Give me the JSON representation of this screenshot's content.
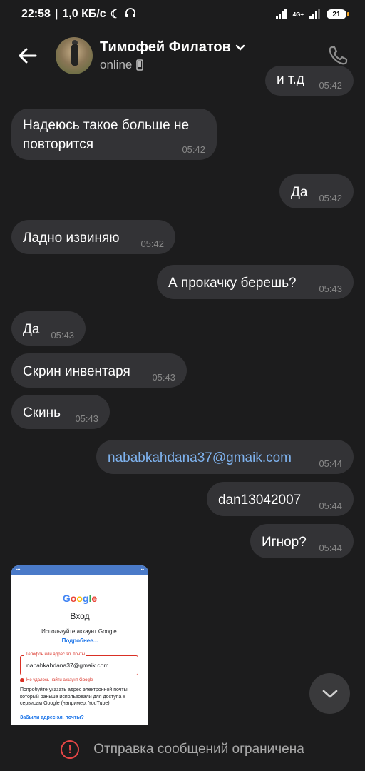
{
  "status_bar": {
    "time": "22:58",
    "speed": "1,0 КБ/с",
    "network": "4G+",
    "battery": "21"
  },
  "header": {
    "name": "Тимофей Филатов",
    "status": "online"
  },
  "messages": [
    {
      "text": "и т.д",
      "time": "05:42",
      "side": "out"
    },
    {
      "text": "Надеюсь такое больше не повторится",
      "time": "05:42",
      "side": "in"
    },
    {
      "text": "Да",
      "time": "05:42",
      "side": "out"
    },
    {
      "text": "Ладно извиняю",
      "time": "05:42",
      "side": "in"
    },
    {
      "text": "А прокачку берешь?",
      "time": "05:43",
      "side": "out"
    },
    {
      "text": "Да",
      "time": "05:43",
      "side": "in"
    },
    {
      "text": "Скрин инвентаря",
      "time": "05:43",
      "side": "in"
    },
    {
      "text": "Скинь",
      "time": "05:43",
      "side": "in"
    },
    {
      "text": "nababkahdana37@gmaik.com",
      "time": "05:44",
      "side": "out"
    },
    {
      "text": "dan13042007",
      "time": "05:44",
      "side": "out"
    },
    {
      "text": "Игнор?",
      "time": "05:44",
      "side": "out"
    }
  ],
  "screenshot": {
    "logo": "Google",
    "title": "Вход",
    "subtitle": "Используйте аккаунт Google.",
    "more": "Подробнее...",
    "field_label": "Телефон или адрес эл. почты",
    "field_value": "nababkahdana37@gmaik.com",
    "error": "Не удалось найти аккаунт Google",
    "hint": "Попробуйте указать адрес электронной почты, который раньше использовали для доступа к сервисам Google (например, YouTube).",
    "forgot": "Забыли адрес эл. почты?"
  },
  "footer": {
    "restricted": "Отправка сообщений ограничена"
  },
  "colors": {
    "background": "#1c1c1d",
    "bubble": "#333336",
    "link": "#7fb3ef",
    "warning": "#e64646"
  }
}
